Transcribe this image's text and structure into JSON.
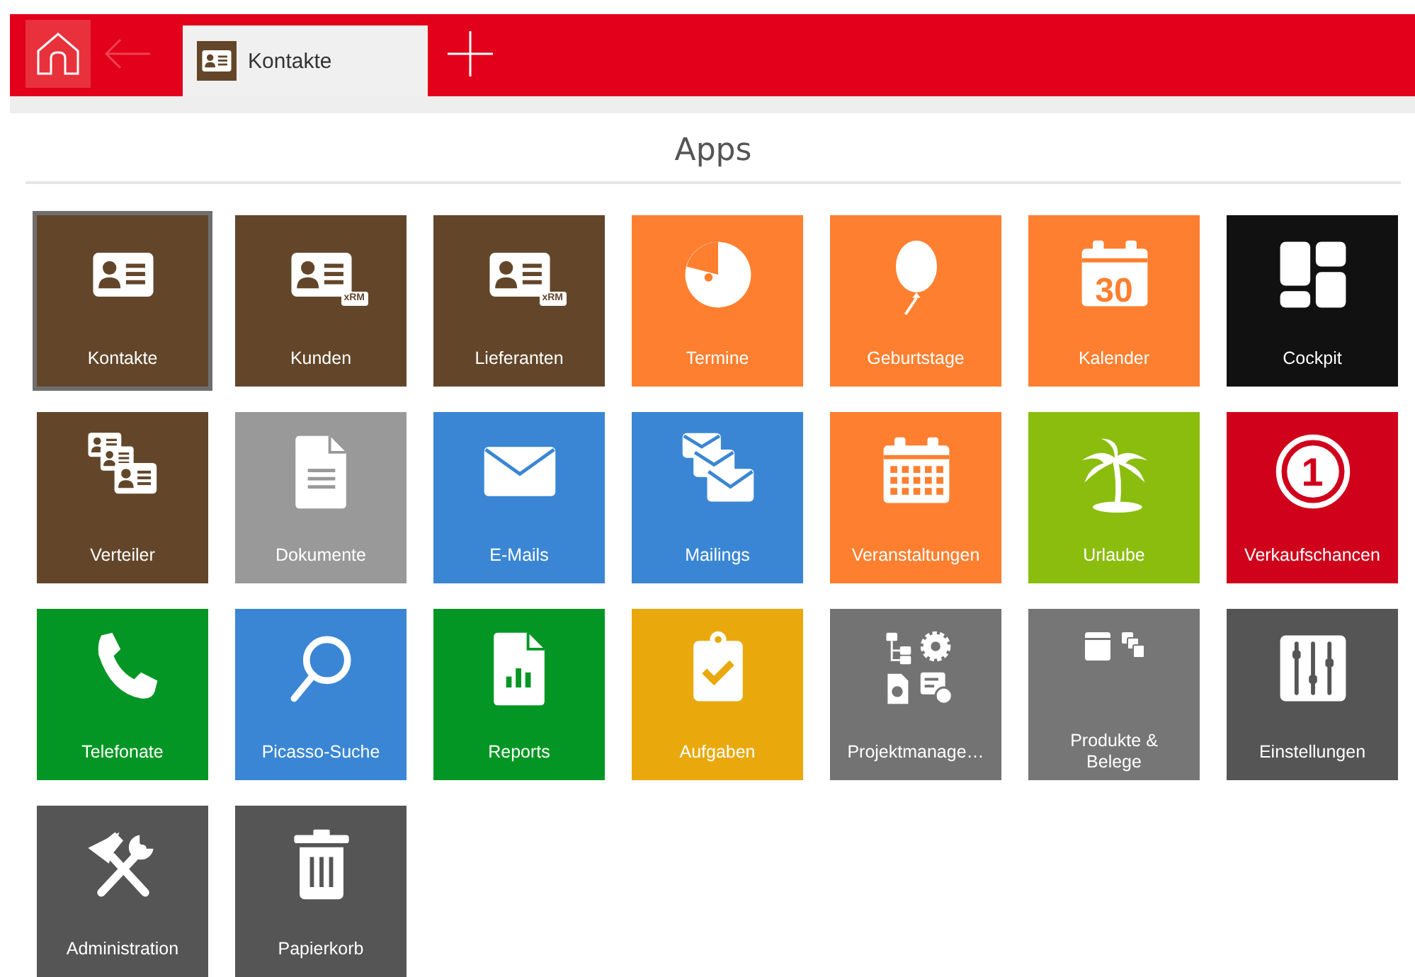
{
  "topbar": {
    "home": {
      "selected": true
    },
    "back": {
      "disabled": true
    },
    "tabs": [
      {
        "label": "Kontakte",
        "selected": true
      }
    ]
  },
  "title": "Apps",
  "tiles": [
    {
      "label": "Kontakte",
      "color": "#63462a",
      "selected": true
    },
    {
      "label": "Kunden",
      "color": "#63462a",
      "selected": false,
      "badge": "xRM"
    },
    {
      "label": "Lieferanten",
      "color": "#63462a",
      "selected": false,
      "badge": "xRM"
    },
    {
      "label": "Termine",
      "color": "#fe7f2f",
      "selected": false
    },
    {
      "label": "Geburtstage",
      "color": "#fe7f2f",
      "selected": false
    },
    {
      "label": "Kalender",
      "color": "#fe7f2f",
      "selected": false,
      "icon_text": "30"
    },
    {
      "label": "Cockpit",
      "color": "#111111",
      "selected": false
    },
    {
      "label": "Verteiler",
      "color": "#63462a",
      "selected": false
    },
    {
      "label": "Dokumente",
      "color": "#999999",
      "selected": false
    },
    {
      "label": "E-Mails",
      "color": "#3a86d4",
      "selected": false
    },
    {
      "label": "Mailings",
      "color": "#3a86d4",
      "selected": false
    },
    {
      "label": "Veranstaltungen",
      "color": "#fe7f2f",
      "selected": false
    },
    {
      "label": "Urlaube",
      "color": "#8bbd0f",
      "selected": false
    },
    {
      "label": "Verkaufschancen",
      "color": "#d0021b",
      "selected": false,
      "icon_text": "1"
    },
    {
      "label": "Telefonate",
      "color": "#049624",
      "selected": false
    },
    {
      "label": "Picasso-Suche",
      "color": "#3a86d4",
      "selected": false
    },
    {
      "label": "Reports",
      "color": "#049624",
      "selected": false
    },
    {
      "label": "Aufgaben",
      "color": "#e9a90c",
      "selected": false
    },
    {
      "label": "Projektmanage…",
      "color": "#737373",
      "selected": false
    },
    {
      "label": "Produkte & Belege",
      "color": "#767676",
      "selected": false
    },
    {
      "label": "Einstellungen",
      "color": "#555555",
      "selected": false
    },
    {
      "label": "Administration",
      "color": "#555555",
      "selected": false
    },
    {
      "label": "Papierkorb",
      "color": "#555555",
      "selected": false
    }
  ]
}
